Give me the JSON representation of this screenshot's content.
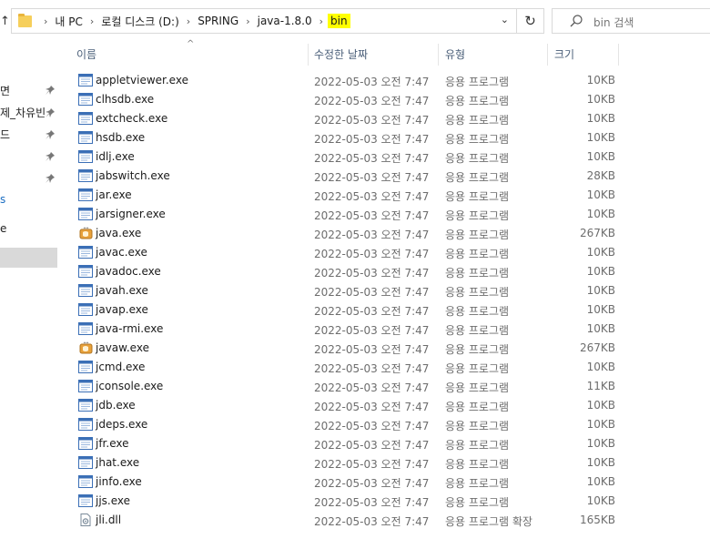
{
  "address": {
    "crumbs": [
      "내 PC",
      "로컬 디스크 (D:)",
      "SPRING",
      "java-1.8.0",
      "bin"
    ]
  },
  "search": {
    "placeholder": "bin 검색"
  },
  "nav": {
    "items": [
      {
        "label": "면",
        "pinned": true
      },
      {
        "label": "제_차유빈",
        "pinned": true
      },
      {
        "label": "드",
        "pinned": true
      },
      {
        "label": "",
        "pinned": true
      },
      {
        "label": "",
        "pinned": true
      },
      {
        "label": "s",
        "pinned": false
      },
      {
        "label": "e",
        "pinned": false
      }
    ]
  },
  "columns": {
    "name": "이름",
    "date": "수정한 날짜",
    "type": "유형",
    "size": "크기"
  },
  "colors": {
    "highlight": "#ffff00",
    "selection": "#d9d9d9",
    "header_text": "#4c607a"
  },
  "files": [
    {
      "name": "appletviewer.exe",
      "date": "2022-05-03 오전 7:47",
      "type": "응용 프로그램",
      "size": "10KB",
      "icon": "exe-window-icon"
    },
    {
      "name": "clhsdb.exe",
      "date": "2022-05-03 오전 7:47",
      "type": "응용 프로그램",
      "size": "10KB",
      "icon": "exe-window-icon"
    },
    {
      "name": "extcheck.exe",
      "date": "2022-05-03 오전 7:47",
      "type": "응용 프로그램",
      "size": "10KB",
      "icon": "exe-window-icon"
    },
    {
      "name": "hsdb.exe",
      "date": "2022-05-03 오전 7:47",
      "type": "응용 프로그램",
      "size": "10KB",
      "icon": "exe-window-icon"
    },
    {
      "name": "idlj.exe",
      "date": "2022-05-03 오전 7:47",
      "type": "응용 프로그램",
      "size": "10KB",
      "icon": "exe-window-icon"
    },
    {
      "name": "jabswitch.exe",
      "date": "2022-05-03 오전 7:47",
      "type": "응용 프로그램",
      "size": "28KB",
      "icon": "exe-window-icon"
    },
    {
      "name": "jar.exe",
      "date": "2022-05-03 오전 7:47",
      "type": "응용 프로그램",
      "size": "10KB",
      "icon": "exe-window-icon"
    },
    {
      "name": "jarsigner.exe",
      "date": "2022-05-03 오전 7:47",
      "type": "응용 프로그램",
      "size": "10KB",
      "icon": "exe-window-icon"
    },
    {
      "name": "java.exe",
      "date": "2022-05-03 오전 7:47",
      "type": "응용 프로그램",
      "size": "267KB",
      "icon": "java-cup-icon"
    },
    {
      "name": "javac.exe",
      "date": "2022-05-03 오전 7:47",
      "type": "응용 프로그램",
      "size": "10KB",
      "icon": "exe-window-icon"
    },
    {
      "name": "javadoc.exe",
      "date": "2022-05-03 오전 7:47",
      "type": "응용 프로그램",
      "size": "10KB",
      "icon": "exe-window-icon"
    },
    {
      "name": "javah.exe",
      "date": "2022-05-03 오전 7:47",
      "type": "응용 프로그램",
      "size": "10KB",
      "icon": "exe-window-icon"
    },
    {
      "name": "javap.exe",
      "date": "2022-05-03 오전 7:47",
      "type": "응용 프로그램",
      "size": "10KB",
      "icon": "exe-window-icon"
    },
    {
      "name": "java-rmi.exe",
      "date": "2022-05-03 오전 7:47",
      "type": "응용 프로그램",
      "size": "10KB",
      "icon": "exe-window-icon"
    },
    {
      "name": "javaw.exe",
      "date": "2022-05-03 오전 7:47",
      "type": "응용 프로그램",
      "size": "267KB",
      "icon": "java-cup-icon"
    },
    {
      "name": "jcmd.exe",
      "date": "2022-05-03 오전 7:47",
      "type": "응용 프로그램",
      "size": "10KB",
      "icon": "exe-window-icon"
    },
    {
      "name": "jconsole.exe",
      "date": "2022-05-03 오전 7:47",
      "type": "응용 프로그램",
      "size": "11KB",
      "icon": "exe-window-icon"
    },
    {
      "name": "jdb.exe",
      "date": "2022-05-03 오전 7:47",
      "type": "응용 프로그램",
      "size": "10KB",
      "icon": "exe-window-icon"
    },
    {
      "name": "jdeps.exe",
      "date": "2022-05-03 오전 7:47",
      "type": "응용 프로그램",
      "size": "10KB",
      "icon": "exe-window-icon"
    },
    {
      "name": "jfr.exe",
      "date": "2022-05-03 오전 7:47",
      "type": "응용 프로그램",
      "size": "10KB",
      "icon": "exe-window-icon"
    },
    {
      "name": "jhat.exe",
      "date": "2022-05-03 오전 7:47",
      "type": "응용 프로그램",
      "size": "10KB",
      "icon": "exe-window-icon"
    },
    {
      "name": "jinfo.exe",
      "date": "2022-05-03 오전 7:47",
      "type": "응용 프로그램",
      "size": "10KB",
      "icon": "exe-window-icon"
    },
    {
      "name": "jjs.exe",
      "date": "2022-05-03 오전 7:47",
      "type": "응용 프로그램",
      "size": "10KB",
      "icon": "exe-window-icon"
    },
    {
      "name": "jli.dll",
      "date": "2022-05-03 오전 7:47",
      "type": "응용 프로그램 확장",
      "size": "165KB",
      "icon": "dll-gear-icon"
    }
  ]
}
